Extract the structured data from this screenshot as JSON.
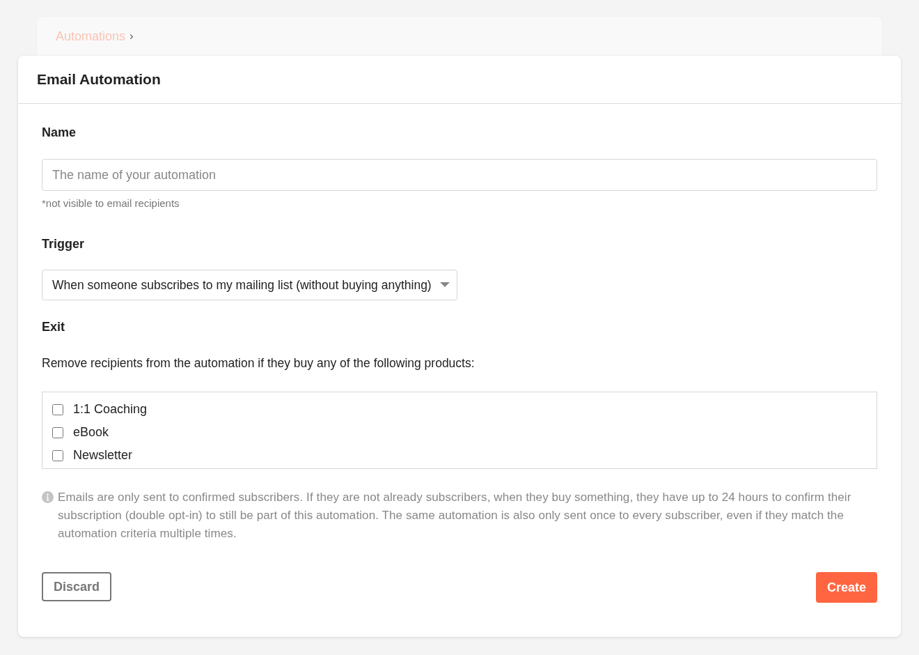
{
  "breadcrumb": {
    "items": [
      {
        "label": "Automations",
        "separator": "›"
      }
    ]
  },
  "card": {
    "title": "Email Automation"
  },
  "name_field": {
    "label": "Name",
    "placeholder": "The name of your automation",
    "hint": "*not visible to email recipients"
  },
  "trigger": {
    "label": "Trigger",
    "value": "When someone subscribes to my mailing list (without buying anything)"
  },
  "exit": {
    "label": "Exit",
    "description": "Remove recipients from the automation if they buy any of the following products:",
    "products": [
      {
        "label": "1:1 Coaching",
        "checked": false
      },
      {
        "label": "eBook",
        "checked": false
      },
      {
        "label": "Newsletter",
        "checked": false
      }
    ]
  },
  "info": "Emails are only sent to confirmed subscribers. If they are not already subscribers, when they buy something, they have up to 24 hours to confirm their subscription (double opt-in) to still be part of this automation. The same automation is also only sent once to every subscriber, even if they match the automation criteria multiple times.",
  "buttons": [
    {
      "label": "Discard",
      "kind": "secondary"
    },
    {
      "label": "Create",
      "kind": "primary"
    }
  ]
}
